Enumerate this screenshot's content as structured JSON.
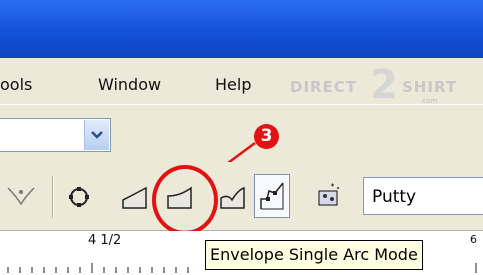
{
  "menubar": {
    "items": [
      "Tools",
      "Window",
      "Help"
    ]
  },
  "menubar_display": {
    "tools": "ools"
  },
  "watermark": {
    "brand": "DIRECT 2 SHIRT",
    "domain": ".com"
  },
  "toolbar2": {
    "buttons": [
      {
        "icon": "envelope-straight-line-icon"
      },
      {
        "icon": "envelope-single-arc-icon"
      },
      {
        "icon": "envelope-double-arc-icon"
      },
      {
        "icon": "envelope-unconstrained-icon"
      },
      {
        "icon": "envelope-interactive-icon"
      },
      {
        "icon": "envelope-node-icon"
      }
    ],
    "preset_value": "Putty"
  },
  "ruler": {
    "label": "4 1/2",
    "next_label": "6"
  },
  "tooltip": {
    "text": "Envelope Single Arc Mode"
  },
  "annotation": {
    "step_number": "3",
    "color": "#e21212"
  }
}
